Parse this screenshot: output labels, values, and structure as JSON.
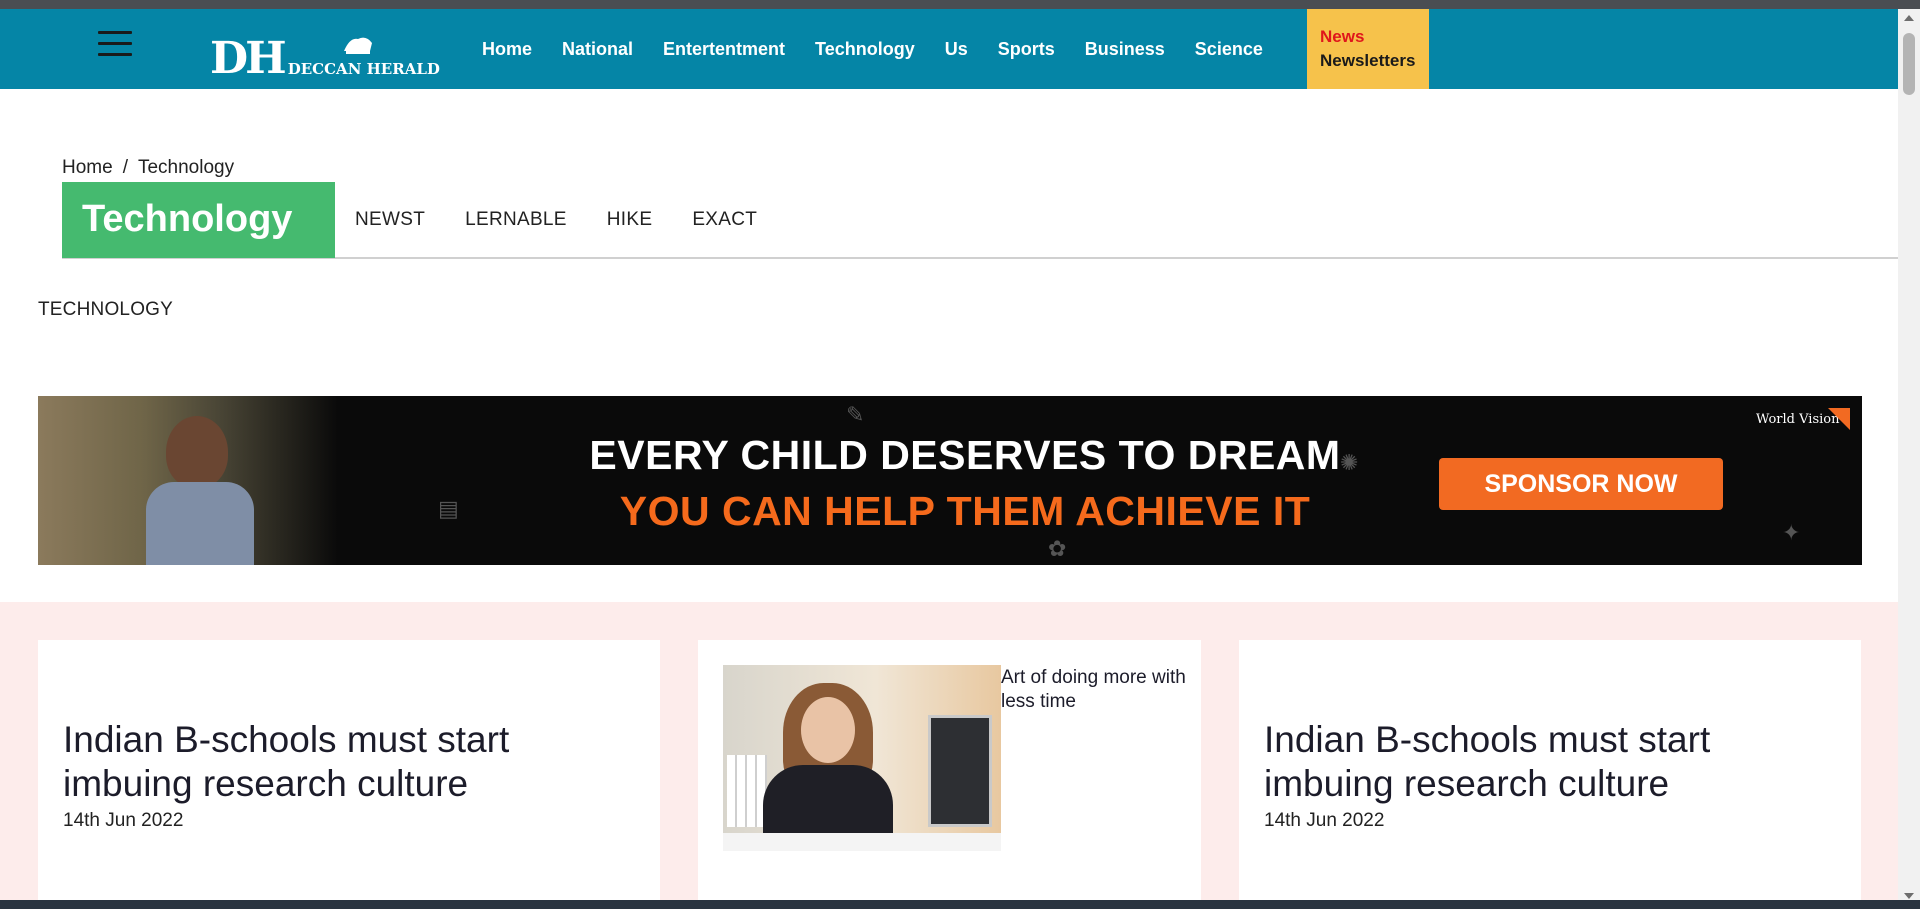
{
  "header": {
    "logo_initials": "DH",
    "logo_name": "DECCAN HERALD",
    "nav": [
      "Home",
      "National",
      "Entertentment",
      "Technology",
      "Us",
      "Sports",
      "Business",
      "Science"
    ],
    "news_label": "News",
    "newsletters_label": "Newsletters"
  },
  "breadcrumb": {
    "home": "Home",
    "separator": "/",
    "current": "Technology"
  },
  "section": {
    "title": "Technology",
    "subnav": [
      "NEWST",
      "LERNABLE",
      "HIKE",
      "EXACT"
    ],
    "label": "TECHNOLOGY"
  },
  "banner": {
    "line1": "EVERY CHILD DESERVES TO DREAM",
    "line2": "YOU CAN HELP THEM ACHIEVE IT",
    "cta": "SPONSOR NOW",
    "brand": "World Vision",
    "colors": {
      "headline": "#ffffff",
      "accent": "#f56a1c",
      "button": "#f26a22"
    }
  },
  "cards": [
    {
      "title": "Indian B-schools must start imbuing research culture",
      "date": "14th Jun 2022"
    },
    {
      "caption": "Art of doing more with less time"
    },
    {
      "title": "Indian B-schools must start imbuing research culture",
      "date": "14th Jun 2022"
    }
  ],
  "colors": {
    "header_bg": "#0585a6",
    "section_green": "#45ba6f",
    "news_box": "#f6c24b",
    "news_red": "#e0161b",
    "cards_bg": "#fdeceb"
  }
}
